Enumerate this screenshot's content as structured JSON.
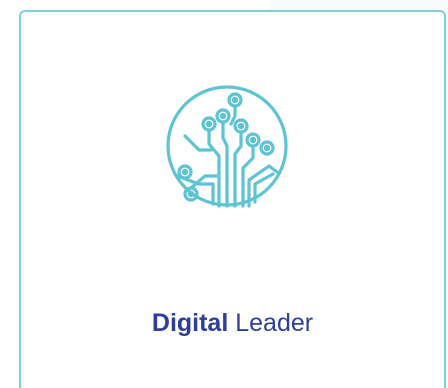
{
  "card": {
    "icon": "digital-tree-circuit-icon",
    "title_bold": "Digital",
    "title_regular": "Leader"
  },
  "colors": {
    "border": "#7ccfdc",
    "icon_stroke": "#5ec3d3",
    "title": "#2d3f96"
  }
}
